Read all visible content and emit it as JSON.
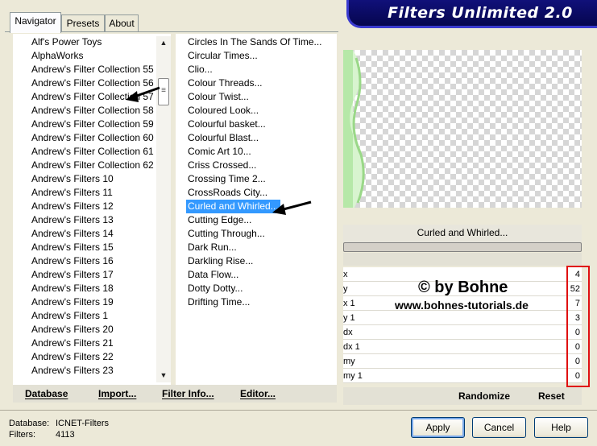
{
  "tabs": [
    {
      "label": "Navigator",
      "active": true
    },
    {
      "label": "Presets",
      "active": false
    },
    {
      "label": "About",
      "active": false
    }
  ],
  "banner_title": "Filters Unlimited 2.0",
  "categories": [
    "Alf's Power Toys",
    "AlphaWorks",
    "Andrew's Filter Collection 55",
    "Andrew's Filter Collection 56",
    "Andrew's Filter Collection 57",
    "Andrew's Filter Collection 58",
    "Andrew's Filter Collection 59",
    "Andrew's Filter Collection 60",
    "Andrew's Filter Collection 61",
    "Andrew's Filter Collection 62",
    "Andrew's Filters 10",
    "Andrew's Filters 11",
    "Andrew's Filters 12",
    "Andrew's Filters 13",
    "Andrew's Filters 14",
    "Andrew's Filters 15",
    "Andrew's Filters 16",
    "Andrew's Filters 17",
    "Andrew's Filters 18",
    "Andrew's Filters 19",
    "Andrew's Filters 1",
    "Andrew's Filters 20",
    "Andrew's Filters 21",
    "Andrew's Filters 22",
    "Andrew's Filters 23"
  ],
  "filters": [
    "Circles In The Sands Of Time...",
    "Circular Times...",
    "Clio...",
    "Colour Threads...",
    "Colour Twist...",
    "Coloured Look...",
    "Colourful basket...",
    "Colourful Blast...",
    "Comic Art 10...",
    "Criss Crossed...",
    "Crossing Time 2...",
    "CrossRoads City...",
    "Curled and Whirled...",
    "Cutting Edge...",
    "Cutting Through...",
    "Dark Run...",
    "Darkling Rise...",
    "Data Flow...",
    "Dotty Dotty...",
    "Drifting Time..."
  ],
  "selected_filter_index": 12,
  "scroll_thumb_glyph": "≡",
  "scroll_up_glyph": "▲",
  "scroll_down_glyph": "▼",
  "actions": {
    "database": "Database",
    "import": "Import...",
    "filter_info": "Filter Info...",
    "editor": "Editor..."
  },
  "current_filter_label": "Curled and Whirled...",
  "params": [
    {
      "label": "x",
      "value": "4"
    },
    {
      "label": "y",
      "value": "52"
    },
    {
      "label": "x 1",
      "value": "7"
    },
    {
      "label": "y 1",
      "value": "3"
    },
    {
      "label": "dx",
      "value": "0"
    },
    {
      "label": "dx 1",
      "value": "0"
    },
    {
      "label": "my",
      "value": "0"
    },
    {
      "label": "my 1",
      "value": "0"
    }
  ],
  "watermark": {
    "line1": "© by Bohne",
    "line2": "www.bohnes-tutorials.de"
  },
  "param_buttons": {
    "randomize": "Randomize",
    "reset": "Reset"
  },
  "info": {
    "database_label": "Database:",
    "database_value": "ICNET-Filters",
    "filters_label": "Filters:",
    "filters_value": "4113"
  },
  "buttons": {
    "apply": "Apply",
    "cancel": "Cancel",
    "help": "Help"
  },
  "colors": {
    "selection": "#3399ff",
    "banner": "#0a0a6a",
    "highlight_box": "#e01010"
  }
}
